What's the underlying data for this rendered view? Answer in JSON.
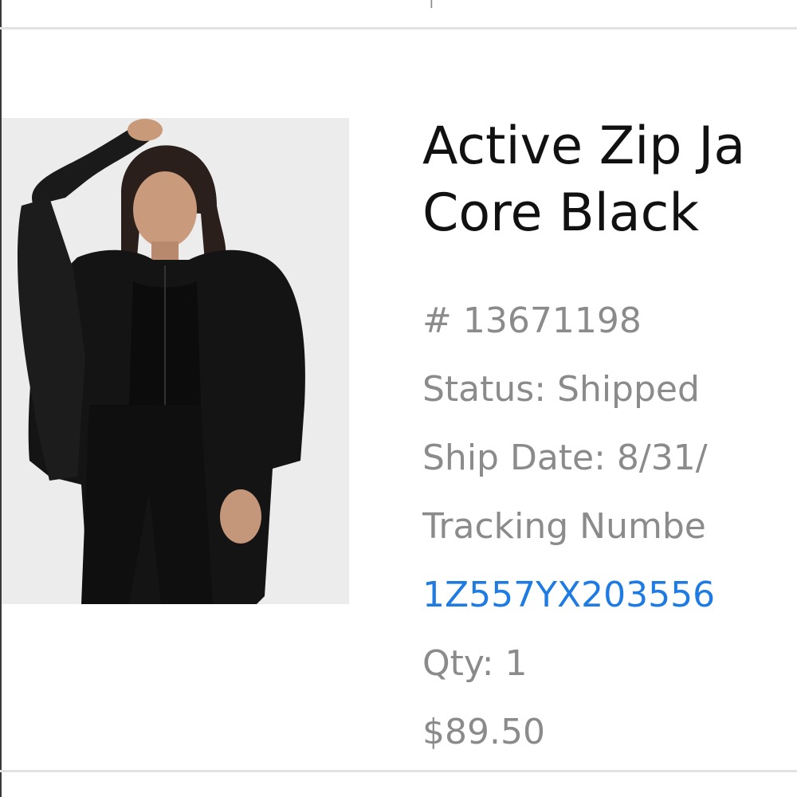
{
  "product": {
    "title_line1": "Active Zip Ja",
    "title_line2": "Core Black",
    "item_number": "# 13671198",
    "status": "Status: Shipped",
    "ship_date": "Ship Date: 8/31/",
    "tracking_label": "Tracking Numbe",
    "tracking_number": "1Z557YX203556",
    "qty": "Qty: 1",
    "price": "$89.50"
  },
  "colors": {
    "title": "#111111",
    "meta": "#8b8b8b",
    "link": "#1e7be3",
    "divider": "#e2e2e2"
  }
}
